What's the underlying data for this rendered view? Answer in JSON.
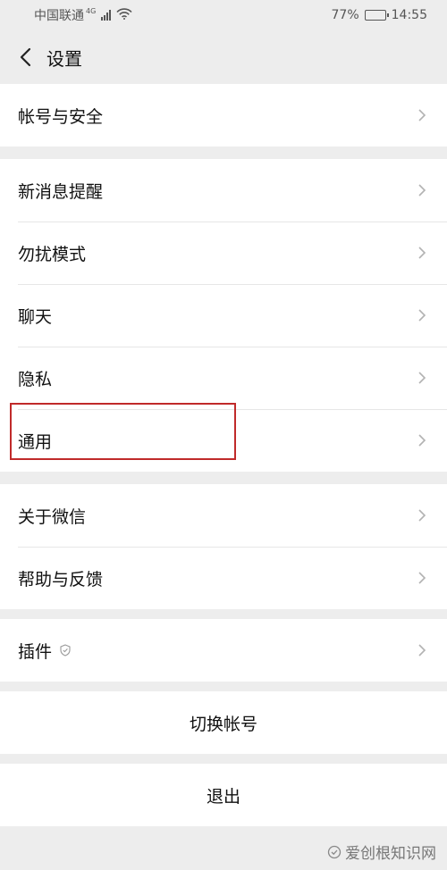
{
  "status_bar": {
    "carrier": "中国联通",
    "network": "4G",
    "battery": "77%",
    "battery_level": 0.77,
    "time": "14:55"
  },
  "nav": {
    "title": "设置"
  },
  "groups": [
    {
      "items": [
        {
          "label": "帐号与安全"
        }
      ]
    },
    {
      "items": [
        {
          "label": "新消息提醒"
        },
        {
          "label": "勿扰模式"
        },
        {
          "label": "聊天"
        },
        {
          "label": "隐私"
        },
        {
          "label": "通用"
        }
      ]
    },
    {
      "items": [
        {
          "label": "关于微信"
        },
        {
          "label": "帮助与反馈"
        }
      ]
    },
    {
      "items": [
        {
          "label": "插件"
        }
      ]
    }
  ],
  "actions": {
    "switch_account": "切换帐号",
    "logout": "退出"
  },
  "watermark": {
    "text": "爱创根知识网"
  },
  "colors": {
    "background": "#ededed",
    "highlight": "#c02a2a"
  }
}
